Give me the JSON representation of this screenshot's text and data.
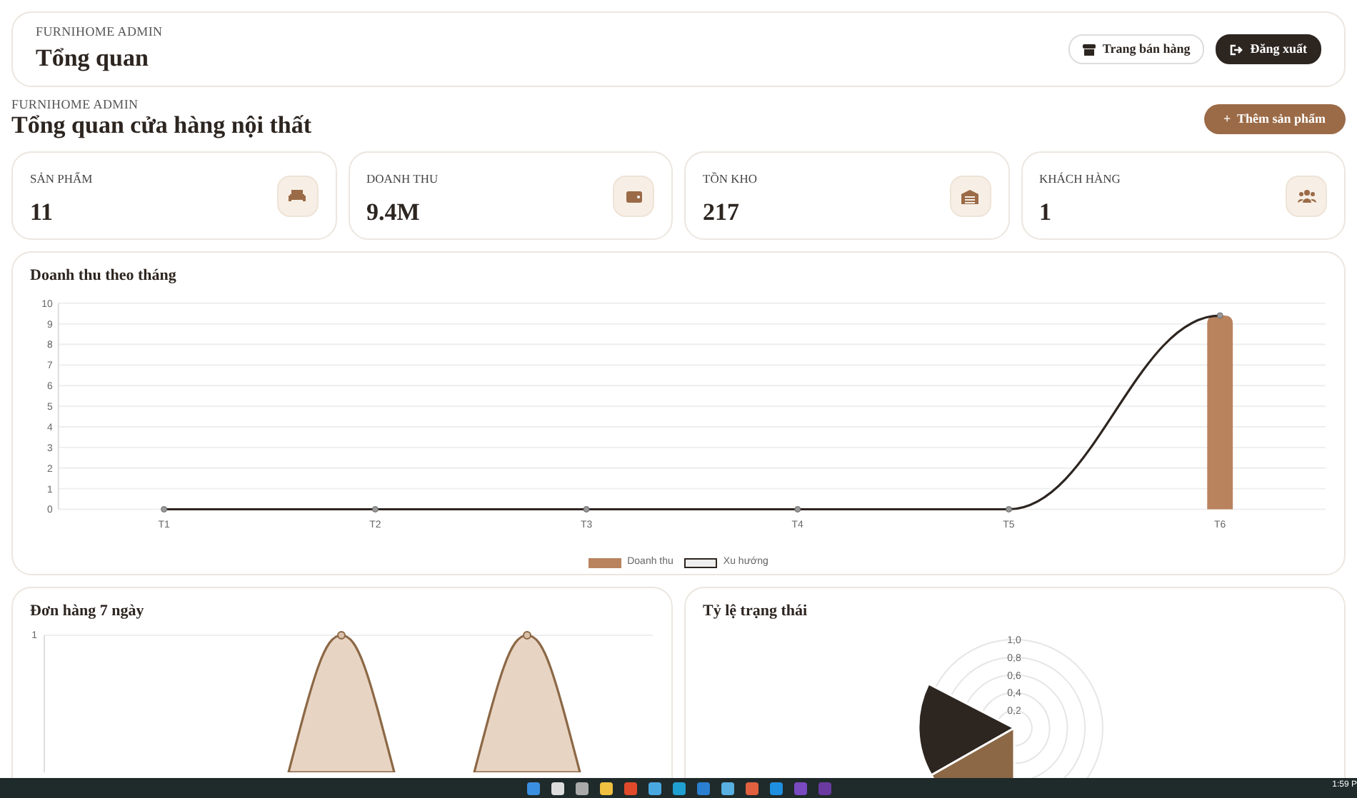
{
  "header": {
    "eyebrow": "FURNIHOME ADMIN",
    "title": "Tổng quan",
    "buttons": [
      {
        "label": "Trang bán hàng",
        "kind": "light"
      },
      {
        "label": "Đăng xuất",
        "kind": "dark"
      }
    ]
  },
  "page": {
    "eyebrow": "FURNIHOME ADMIN",
    "title": "Tổng quan cửa hàng nội thất",
    "action": "Thêm sản phẩm",
    "action_icon": "+"
  },
  "stats": [
    {
      "label": "SẢN PHẨM",
      "value": "11"
    },
    {
      "label": "DOANH THU",
      "value": "9.4M"
    },
    {
      "label": "TỒN KHO",
      "value": "217"
    },
    {
      "label": "KHÁCH HÀNG",
      "value": "1"
    }
  ],
  "revenue": {
    "title": "Doanh thu theo tháng",
    "chart_data": {
      "type": "bar",
      "categories": [
        "T1",
        "T2",
        "T3",
        "T4",
        "T5",
        "T6"
      ],
      "series": [
        {
          "name": "Doanh thu",
          "color": "#b9835e",
          "values": [
            0,
            0,
            0,
            0,
            0,
            9.4
          ]
        },
        {
          "name": "Xu hướng",
          "color": "#2d2520",
          "type": "line",
          "marker": "circle",
          "values": [
            0,
            0,
            0,
            0,
            0,
            9.4
          ]
        }
      ],
      "legend": "bottom",
      "grid": true,
      "ylim": [
        0,
        10
      ],
      "yticks": [
        0,
        1,
        2,
        3,
        4,
        5,
        6,
        7,
        8,
        9,
        10
      ]
    }
  },
  "orders": {
    "title": "Đơn hàng 7 ngày",
    "y_tick": "1"
  },
  "status": {
    "title": "Tỷ lệ trạng thái",
    "ticks": [
      "1,0",
      "0,8",
      "0,6",
      "0,4",
      "0,2"
    ]
  },
  "taskbar": {
    "clock": "1:59 P"
  }
}
